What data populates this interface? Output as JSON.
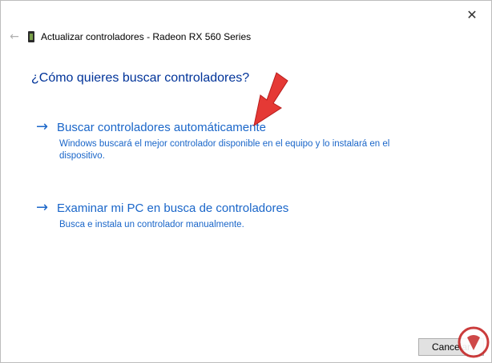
{
  "window": {
    "title": "Actualizar controladores - Radeon RX 560 Series",
    "close_glyph": "✕",
    "back_glyph": "←"
  },
  "main": {
    "question": "¿Cómo quieres buscar controladores?",
    "options": [
      {
        "arrow": "→",
        "title": "Buscar controladores automáticamente",
        "description": "Windows buscará el mejor controlador disponible en el equipo y lo instalará en el dispositivo."
      },
      {
        "arrow": "→",
        "title": "Examinar mi PC en busca de controladores",
        "description": "Busca e instala un controlador manualmente."
      }
    ]
  },
  "footer": {
    "cancel_label": "Cancelar"
  },
  "colors": {
    "link": "#1a66c9",
    "question": "#003399",
    "annotation": "#e53935"
  },
  "icons": {
    "device": "graphics-card-icon",
    "back": "back-arrow-icon",
    "close": "close-icon"
  }
}
